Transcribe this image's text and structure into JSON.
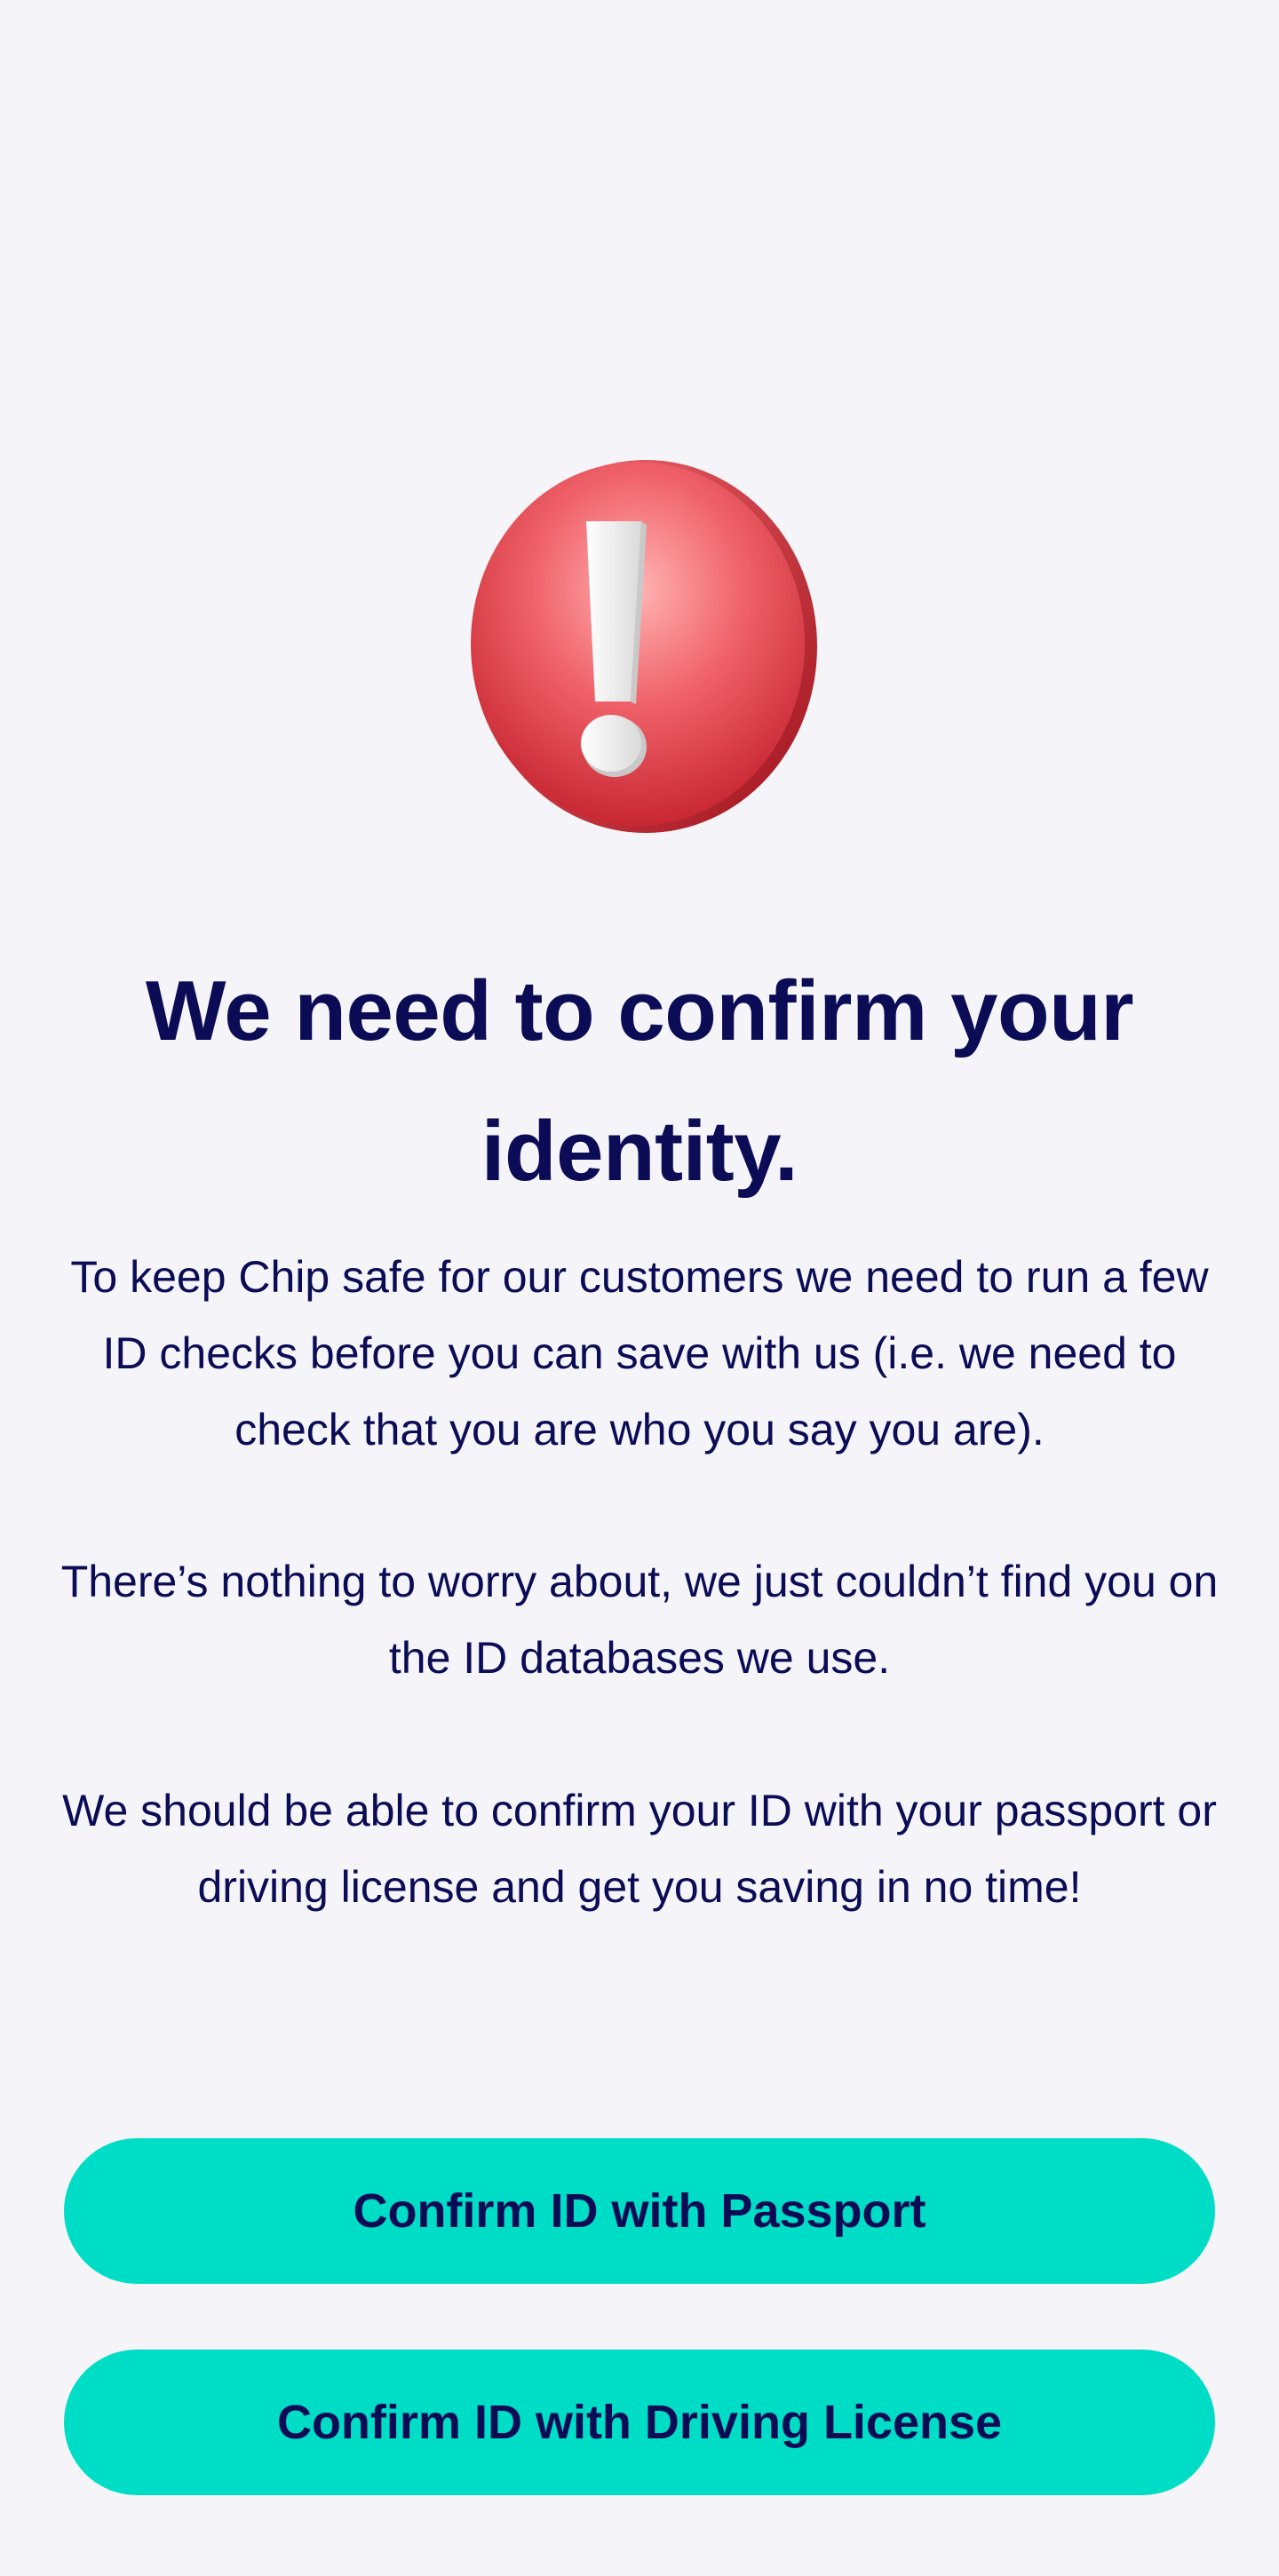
{
  "colors": {
    "background": "#F4F4F9",
    "text": "#0B0C55",
    "button": "#00DDC6",
    "alert_red": "#E83A40"
  },
  "header": {
    "icon": "exclamation-alert-icon",
    "title": "We need to confirm your identity."
  },
  "body": {
    "paragraphs": [
      "To keep Chip safe for our customers we need to run a few ID checks before you can save with us (i.e. we need to check that you are who you say you are).",
      "There’s nothing to worry about, we just couldn’t find you on the ID databases we use.",
      "We should be able to confirm your ID with your passport or driving license and get you saving in no time!"
    ]
  },
  "actions": {
    "passport_label": "Confirm ID with Passport",
    "driving_license_label": "Confirm ID with Driving License"
  }
}
